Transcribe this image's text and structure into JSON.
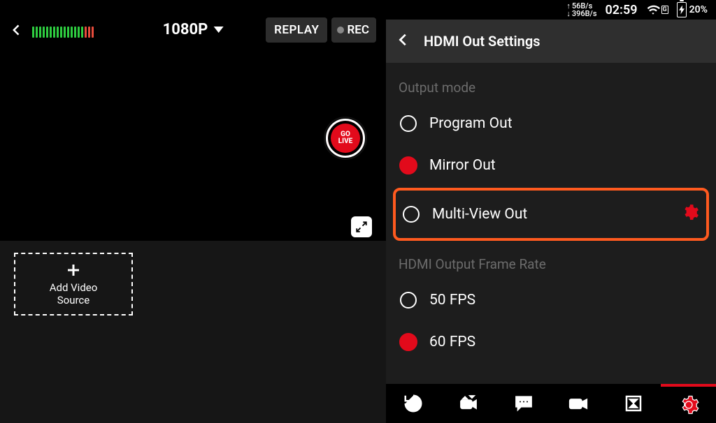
{
  "statusbar": {
    "net_up": "56B/s",
    "net_down": "396B/s",
    "time": "02:59",
    "battery_pct": "20%",
    "wifi_badge": "G"
  },
  "left": {
    "resolution": "1080P",
    "replay_label": "REPLAY",
    "rec_label": "REC",
    "golive_line1": "GO",
    "golive_line2": "LIVE",
    "add_tile_label": "Add Video\nSource"
  },
  "panel": {
    "title": "HDMI Out Settings",
    "section_output_mode": "Output mode",
    "section_fps": "HDMI Output Frame Rate",
    "opts_output": [
      {
        "label": "Program Out",
        "selected": false
      },
      {
        "label": "Mirror Out",
        "selected": true
      },
      {
        "label": "Multi-View Out",
        "selected": false,
        "has_gear": true,
        "highlighted": true
      }
    ],
    "opts_fps": [
      {
        "label": "50 FPS",
        "selected": false
      },
      {
        "label": "60 FPS",
        "selected": true
      }
    ]
  }
}
